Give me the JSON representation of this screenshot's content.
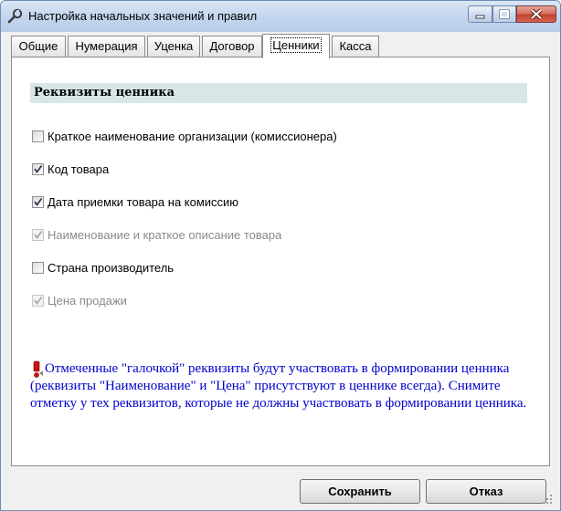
{
  "window": {
    "title": "Настройка начальных значений и правил"
  },
  "tabs": [
    {
      "label": "Общие",
      "active": false
    },
    {
      "label": "Нумерация",
      "active": false
    },
    {
      "label": "Уценка",
      "active": false
    },
    {
      "label": "Договор",
      "active": false
    },
    {
      "label": "Ценники",
      "active": true
    },
    {
      "label": "Касса",
      "active": false
    }
  ],
  "section": {
    "title": "Реквизиты ценника"
  },
  "checkboxes": [
    {
      "label": "Краткое наименование организации (комиссионера)",
      "checked": false,
      "enabled": true
    },
    {
      "label": "Код товара",
      "checked": true,
      "enabled": true
    },
    {
      "label": "Дата приемки товара на комиссию",
      "checked": true,
      "enabled": true
    },
    {
      "label": "Наименование и краткое описание товара",
      "checked": true,
      "enabled": false
    },
    {
      "label": "Страна производитель",
      "checked": false,
      "enabled": true
    },
    {
      "label": "Цена продажи",
      "checked": true,
      "enabled": false
    }
  ],
  "note": {
    "icon": "exclamation-icon",
    "text": "Отмеченные \"галочкой\" реквизиты будут участвовать в формировании ценника (реквизиты \"Наименование\" и \"Цена\" присутствуют в ценнике всегда). Снимите отметку у тех реквизитов, которые не должны участвовать в формировании ценника.",
    "color": "#0000cc"
  },
  "buttons": {
    "save_label": "Сохранить",
    "cancel_label": "Отказ"
  },
  "colors": {
    "section_header_bg": "#d8e6e6",
    "titlebar": "#c4d6ee"
  }
}
